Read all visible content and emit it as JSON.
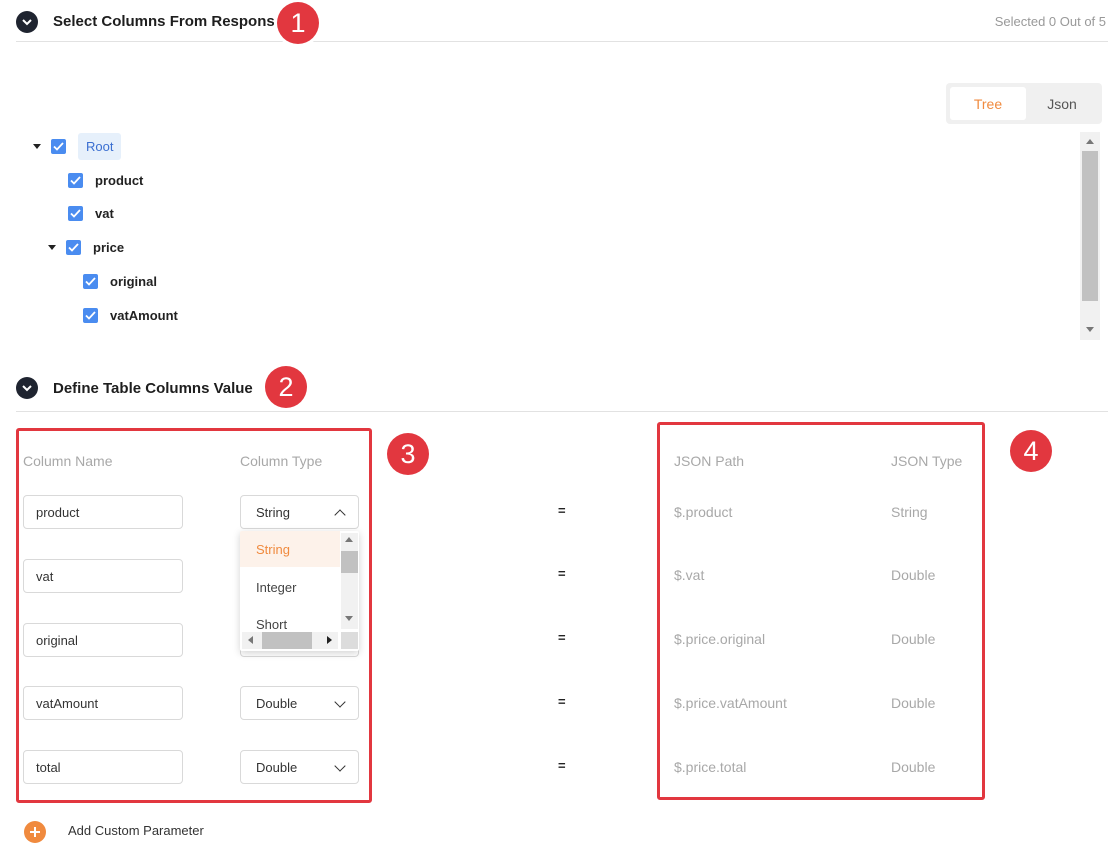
{
  "section1": {
    "title": "Select Columns From Response",
    "selected_count": "Selected 0 Out of 5",
    "badge": "1"
  },
  "view_toggle": {
    "tree": "Tree",
    "json": "Json",
    "active": "Tree"
  },
  "tree": {
    "root": "Root",
    "items": [
      {
        "label": "product",
        "checked": true
      },
      {
        "label": "vat",
        "checked": true
      },
      {
        "label": "price",
        "checked": true
      },
      {
        "label": "original",
        "checked": true
      },
      {
        "label": "vatAmount",
        "checked": true
      }
    ]
  },
  "section2": {
    "title": "Define Table Columns Value",
    "badge": "2"
  },
  "columns_panel": {
    "badge": "3",
    "header_name": "Column Name",
    "header_type": "Column Type",
    "rows": [
      {
        "name": "product",
        "type": "String"
      },
      {
        "name": "vat",
        "type": ""
      },
      {
        "name": "original",
        "type": ""
      },
      {
        "name": "vatAmount",
        "type": "Double"
      },
      {
        "name": "total",
        "type": "Double"
      }
    ]
  },
  "type_dropdown": {
    "options": [
      "String",
      "Integer",
      "Short"
    ],
    "selected": "String"
  },
  "equals_sign": "=",
  "json_panel": {
    "badge": "4",
    "header_path": "JSON Path",
    "header_type": "JSON Type",
    "rows": [
      {
        "path": "$.product",
        "type": "String"
      },
      {
        "path": "$.vat",
        "type": "Double"
      },
      {
        "path": "$.price.original",
        "type": "Double"
      },
      {
        "path": "$.price.vatAmount",
        "type": "Double"
      },
      {
        "path": "$.price.total",
        "type": "Double"
      }
    ]
  },
  "add_custom": {
    "label": "Add Custom Parameter"
  },
  "colors": {
    "accent": "#f08a3e",
    "checkbox": "#4a8cf0",
    "annotation": "#e2373f",
    "dark": "#1f2430"
  }
}
